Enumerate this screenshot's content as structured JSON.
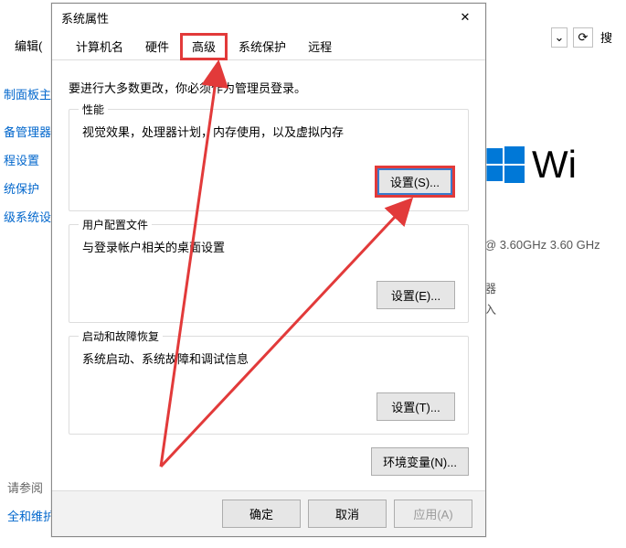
{
  "background": {
    "edit_label": "编辑(",
    "refresh_glyph": "⟳",
    "search_label": "搜",
    "dropdown_glyph": "⌄",
    "left_links": [
      "制面板主页",
      "备管理器",
      "程设置",
      "统保护",
      "级系统设置"
    ],
    "see_also": "请参阅",
    "security_link": "全和维护",
    "win_text": "Wi",
    "cpu_line": "@ 3.60GHz   3.60 GHz",
    "right_cropped_1": "器",
    "right_cropped_2": "入"
  },
  "dialog": {
    "title": "系统属性",
    "close_glyph": "✕",
    "tabs": [
      {
        "label": "计算机名",
        "active": false
      },
      {
        "label": "硬件",
        "active": false
      },
      {
        "label": "高级",
        "active": true,
        "boxed": true
      },
      {
        "label": "系统保护",
        "active": false
      },
      {
        "label": "远程",
        "active": false
      }
    ],
    "admin_note": "要进行大多数更改，你必须作为管理员登录。",
    "perf": {
      "title": "性能",
      "desc": "视觉效果，处理器计划，内存使用，以及虚拟内存",
      "btn": "设置(S)..."
    },
    "profile": {
      "title": "用户配置文件",
      "desc": "与登录帐户相关的桌面设置",
      "btn": "设置(E)..."
    },
    "startup": {
      "title": "启动和故障恢复",
      "desc": "系统启动、系统故障和调试信息",
      "btn": "设置(T)..."
    },
    "env_btn": "环境变量(N)...",
    "ok": "确定",
    "cancel": "取消",
    "apply": "应用(A)"
  }
}
